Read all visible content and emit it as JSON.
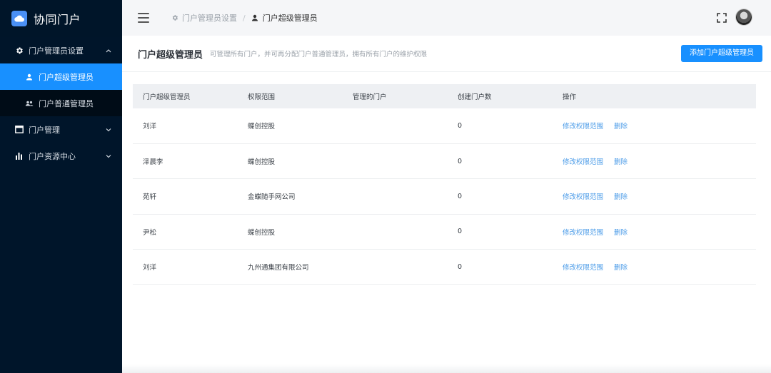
{
  "app": {
    "title": "协同门户",
    "accent": "#1890ff"
  },
  "sidebar": {
    "items": [
      {
        "label": "门户管理员设置",
        "icon": "gear-icon",
        "expanded": true,
        "children": [
          {
            "label": "门户超级管理员",
            "icon": "user-icon",
            "active": true
          },
          {
            "label": "门户普通管理员",
            "icon": "users-icon",
            "active": false
          }
        ]
      },
      {
        "label": "门户管理",
        "icon": "window-icon",
        "expanded": false
      },
      {
        "label": "门户资源中心",
        "icon": "bar-chart-icon",
        "expanded": false
      }
    ]
  },
  "header": {
    "breadcrumb": [
      {
        "label": "门户管理员设置",
        "icon": "gear-icon"
      },
      {
        "label": "门户超级管理员",
        "icon": "user-icon"
      }
    ],
    "separator": "/"
  },
  "page": {
    "title": "门户超级管理员",
    "description": "可管理所有门户，并可再分配门户普通管理员，拥有所有门户的维护权限",
    "add_button": "添加门户超级管理员"
  },
  "table": {
    "columns": [
      "门户超级管理员",
      "权限范围",
      "管理的门户",
      "创建门户数",
      "操作"
    ],
    "rows": [
      {
        "name": "刘洋",
        "scope": "蝶创控股",
        "portals": "",
        "count": "0"
      },
      {
        "name": "泽晨李",
        "scope": "蝶创控股",
        "portals": "",
        "count": "0"
      },
      {
        "name": "苑轩",
        "scope": "金蝶随手网公司",
        "portals": "",
        "count": "0"
      },
      {
        "name": "尹松",
        "scope": "蝶创控股",
        "portals": "",
        "count": "0"
      },
      {
        "name": "刘洋",
        "scope": "九州通集团有限公司",
        "portals": "",
        "count": "0"
      }
    ],
    "actions": {
      "edit": "修改权限范围",
      "delete": "删除"
    }
  }
}
